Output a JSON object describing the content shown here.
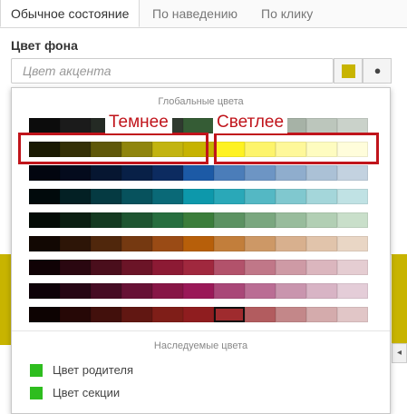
{
  "tabs": [
    {
      "label": "Обычное состояние",
      "active": true
    },
    {
      "label": "По наведению",
      "active": false
    },
    {
      "label": "По клику",
      "active": false
    }
  ],
  "field": {
    "label": "Цвет фона",
    "placeholder": "Цвет акцента",
    "swatch_color": "#c8b400",
    "globe_icon": "globe-icon"
  },
  "palette": {
    "global_title": "Глобальные цвета",
    "base_column": 5,
    "selected": {
      "row": 8,
      "col": 6
    },
    "rows": [
      [
        "#0c0c0c",
        "#1b1b1b",
        "#242a24",
        "#2c322c",
        "#2f3a2f",
        "#355c35",
        "#677a67",
        "#8a9a8a",
        "#a6b2a6",
        "#bcc6bc",
        "#cad2ca"
      ],
      [
        "#1a1a03",
        "#343006",
        "#5f5809",
        "#8f850d",
        "#c2b410",
        "#c6b300",
        "#fef221",
        "#fdf46b",
        "#fef89a",
        "#fefcc0",
        "#fffddb"
      ],
      [
        "#02050f",
        "#040b1d",
        "#061631",
        "#082047",
        "#0c2b60",
        "#1c5aa6",
        "#4b7db9",
        "#6d95c4",
        "#8fadcd",
        "#abc1d6",
        "#c3d2e0"
      ],
      [
        "#010a0c",
        "#032024",
        "#053a42",
        "#07525d",
        "#0a6977",
        "#0d98ab",
        "#2aa8b8",
        "#54b8c4",
        "#80c8cf",
        "#a4d6da",
        "#c0e2e4"
      ],
      [
        "#040b06",
        "#0b1f12",
        "#143a21",
        "#1e5531",
        "#276e3f",
        "#3b7d3b",
        "#5c9262",
        "#7aa77f",
        "#98bc9c",
        "#b2cfb4",
        "#c9dfca"
      ],
      [
        "#120803",
        "#2d1507",
        "#50270c",
        "#753911",
        "#9a4b15",
        "#b75f0a",
        "#c27e3b",
        "#cd9866",
        "#d8b08e",
        "#e1c4ab",
        "#e9d6c5"
      ],
      [
        "#100205",
        "#2a0710",
        "#4a0e1c",
        "#6b1427",
        "#8c1a34",
        "#a0283e",
        "#b2526b",
        "#c07788",
        "#ce9aa5",
        "#dbb6be",
        "#e5cdd2"
      ],
      [
        "#0e0208",
        "#270614",
        "#460c24",
        "#671135",
        "#871646",
        "#9a1958",
        "#a94778",
        "#ba6d94",
        "#c995ae",
        "#d8b4c5",
        "#e4cdd8"
      ],
      [
        "#0d0302",
        "#260806",
        "#42100c",
        "#611712",
        "#7f1e18",
        "#8f1d1f",
        "#9f2b2e",
        "#b25c5f",
        "#c38789",
        "#d4abac",
        "#e1c6c7"
      ]
    ]
  },
  "inherited": {
    "title": "Наследуемые цвета",
    "items": [
      {
        "label": "Цвет родителя",
        "color": "#2ebd1f"
      },
      {
        "label": "Цвет секции",
        "color": "#2ebd1f"
      }
    ]
  },
  "annotations": {
    "darker": "Темнее",
    "lighter": "Светлее",
    "color": "#c0141b"
  }
}
